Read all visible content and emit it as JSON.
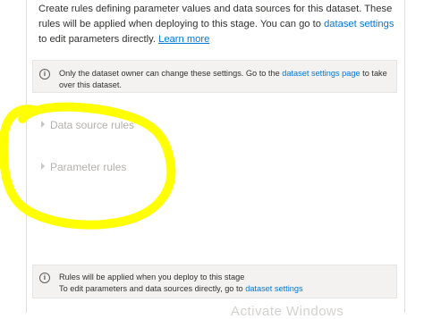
{
  "intro": {
    "text": "Create rules defining parameter values and data sources for this dataset. These rules will be applied when deploying to this stage. You can go to",
    "dataset_settings_link": "dataset settings",
    "text_after": "to edit parameters directly.",
    "learn_more_link": "Learn more"
  },
  "owner_notice": {
    "icon": "info-icon",
    "text": "Only the dataset owner can change these settings. Go to the",
    "link": "dataset settings page",
    "text_after": "to take over this dataset."
  },
  "rules": {
    "data_source_label": "Data source rules",
    "parameter_label": "Parameter rules"
  },
  "deploy_notice": {
    "icon": "info-icon",
    "line1": "Rules will be applied when you deploy to this stage",
    "line2": "To edit parameters and data sources directly, go to",
    "link": "dataset settings"
  },
  "watermark": "Activate Windows",
  "annotation_color": "#ffff00"
}
